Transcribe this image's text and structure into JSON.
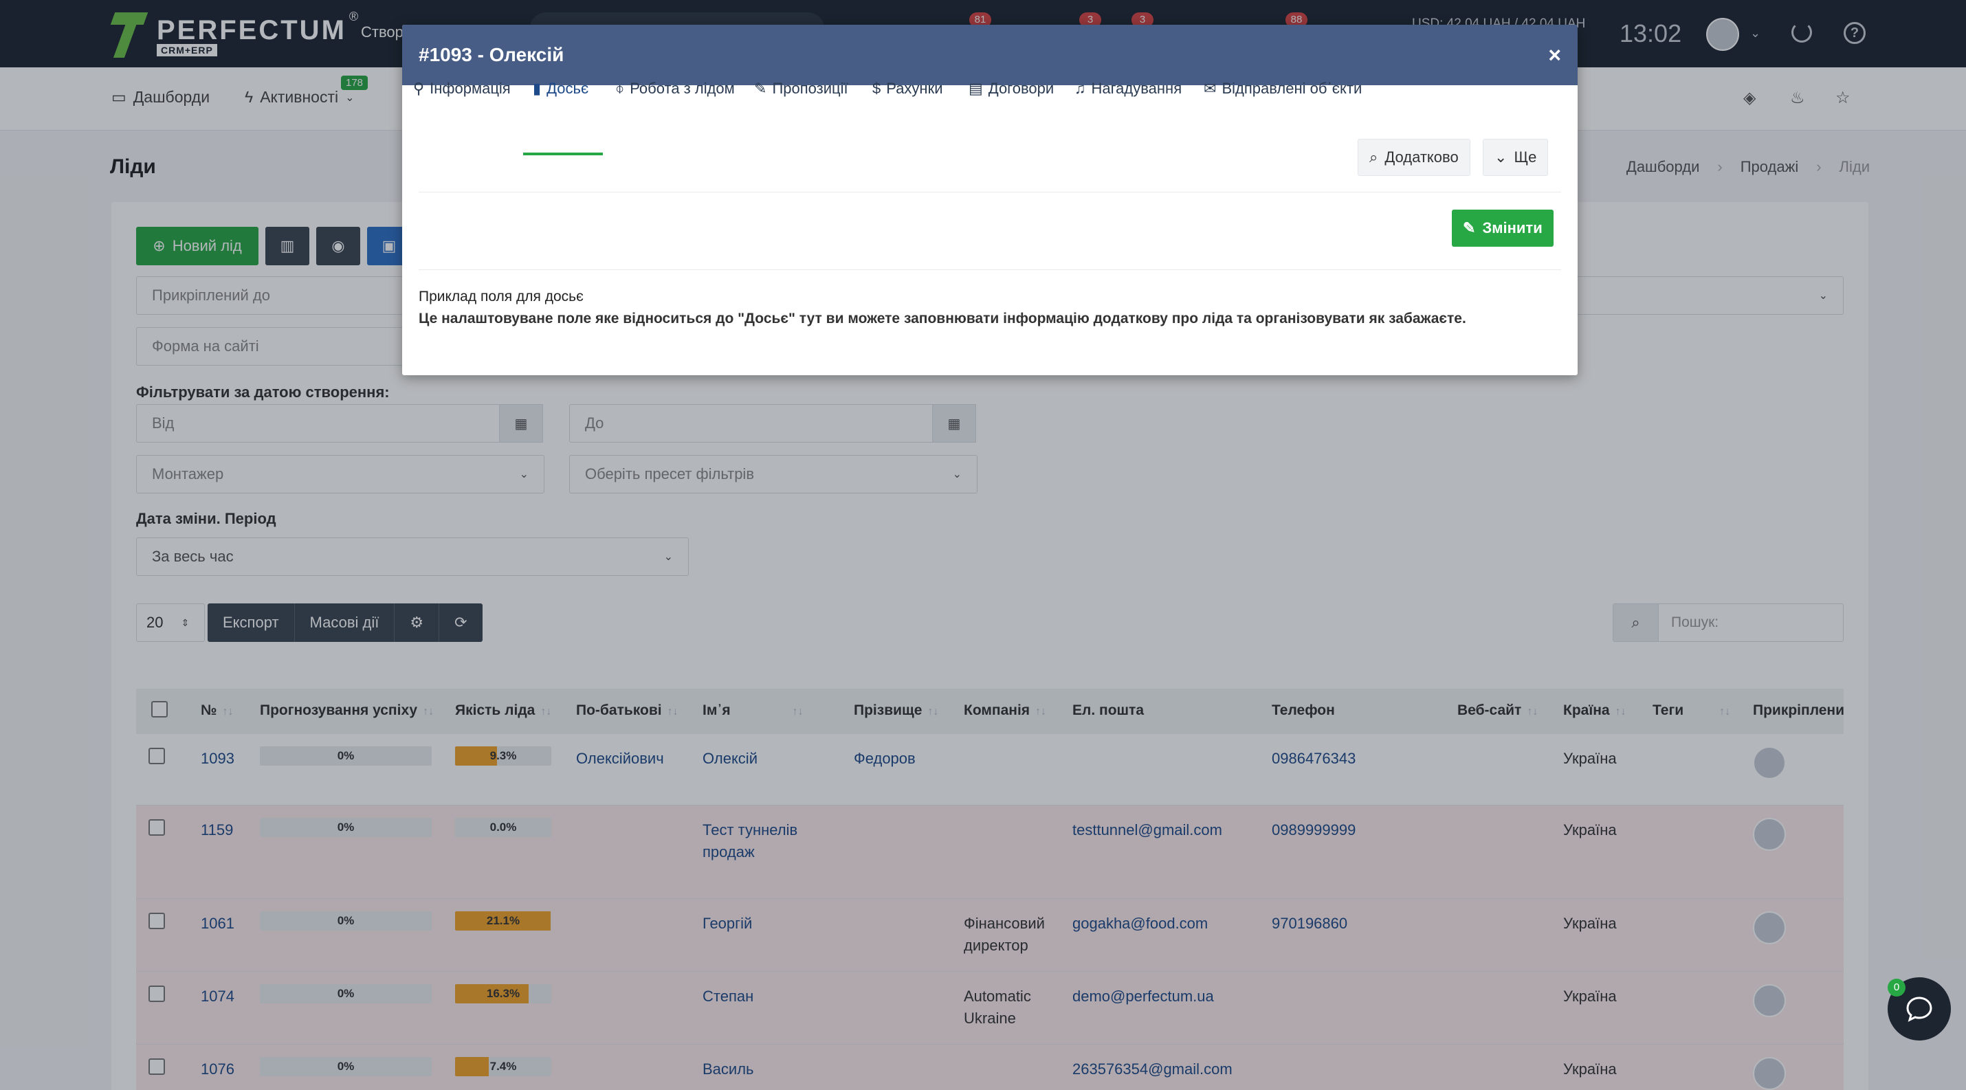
{
  "topbar": {
    "brand": "PERFECTUM",
    "brand_sub": "CRM+ERP",
    "brand_reg": "®",
    "create_label": "Створ",
    "badges": [
      "81",
      "3",
      "3",
      "88"
    ],
    "currency_line1": "USD: 42.04 UAH / 42.04 UAH",
    "currency_line2": "AH",
    "time": "13:02"
  },
  "subnav": {
    "dashboards": "Дашборди",
    "activities": "Активності",
    "activities_badge": "178"
  },
  "page": {
    "title": "Ліди",
    "breadcrumb": [
      "Дашборди",
      "Продажі",
      "Ліди"
    ]
  },
  "filters": {
    "new_lead": "Новий лід",
    "attached_to": "Прикріплений до",
    "site_form": "Форма на сайті",
    "date_created_label": "Фільтрувати за датою створення:",
    "from_placeholder": "Від",
    "to_placeholder": "До",
    "installer": "Монтажер",
    "preset": "Оберіть пресет фільтрів",
    "change_date_label": "Дата зміни. Період",
    "period": "За весь час"
  },
  "table_controls": {
    "per_page": "20",
    "export": "Експорт",
    "bulk": "Масові дії",
    "search_placeholder": "Пошук:"
  },
  "table": {
    "headers": {
      "num": "№",
      "forecast": "Прогнозування успіху",
      "quality": "Якість ліда",
      "patronymic": "По-батькові",
      "name": "Ім᾽я",
      "surname": "Прізвище",
      "company": "Компанія",
      "email": "Ел. пошта",
      "phone": "Телефон",
      "website": "Веб-сайт",
      "country": "Країна",
      "tags": "Теги",
      "attached": "Прикріплени"
    },
    "rows": [
      {
        "num": "1093",
        "forecast": "0%",
        "quality": "9.3%",
        "quality_value": 9.3,
        "patronymic": "Олексійович",
        "name": "Олексій",
        "name2": "",
        "surname": "Федоров",
        "company": "",
        "company2": "",
        "email": "",
        "phone": "0986476343",
        "country": "Україна"
      },
      {
        "num": "1159",
        "forecast": "0%",
        "quality": "0.0%",
        "quality_value": 0,
        "patronymic": "",
        "name": "Тест туннелів",
        "name2": "продаж",
        "surname": "",
        "company": "",
        "company2": "",
        "email": "testtunnel@gmail.com",
        "phone": "0989999999",
        "country": "Україна"
      },
      {
        "num": "1061",
        "forecast": "0%",
        "quality": "21.1%",
        "quality_value": 21.1,
        "patronymic": "",
        "name": "Георгій",
        "name2": "",
        "surname": "",
        "company": "Фінансовий",
        "company2": "директор",
        "email": "gogakha@food.com",
        "phone": "970196860",
        "country": "Україна"
      },
      {
        "num": "1074",
        "forecast": "0%",
        "quality": "16.3%",
        "quality_value": 16.3,
        "patronymic": "",
        "name": "Степан",
        "name2": "",
        "surname": "",
        "company": "Automatic",
        "company2": "Ukraine",
        "email": "demo@perfectum.ua",
        "phone": "",
        "country": "Україна"
      },
      {
        "num": "1076",
        "forecast": "0%",
        "quality": "7.4%",
        "quality_value": 7.4,
        "patronymic": "",
        "name": "Василь",
        "name2": "",
        "surname": "",
        "company": "",
        "company2": "",
        "email": "263576354@gmail.com",
        "phone": "",
        "country": "Україна"
      }
    ]
  },
  "modal": {
    "title": "#1093 - Олексій",
    "close": "×",
    "tabs": [
      "Інформація",
      "Досьє",
      "Робота з лідом",
      "Пропозиції",
      "Рахунки",
      "Договори",
      "Нагадування",
      "Відправлені об᾽єкти"
    ],
    "additional": "Додатково",
    "more": "Ще",
    "edit": "Змінити",
    "dossier_field_label": "Приклад поля для досьє",
    "dossier_field_value": "Це налаштовуване поле яке відноситься до \"Досьє\" тут ви можете заповнювати інформацію додаткову про ліда та організовувати як забажаєте."
  },
  "chat": {
    "badge": "0"
  },
  "colors": {
    "topbar": "#1d2531",
    "modal_header": "#485d86",
    "green": "#28a745",
    "link": "#1e4a8a",
    "quality_bar": "#f0a32b"
  }
}
